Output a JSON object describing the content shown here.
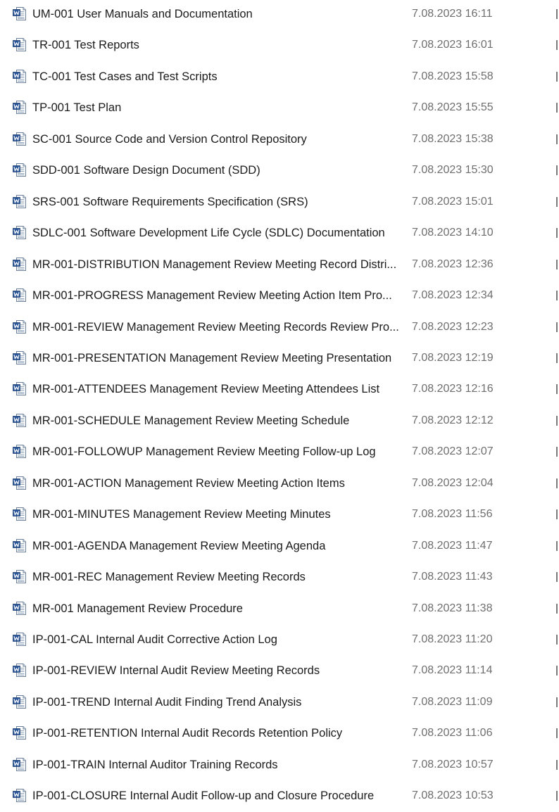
{
  "files": [
    {
      "name": "UM-001 User Manuals and Documentation",
      "modified": "7.08.2023 16:11",
      "icon": "word-document-icon"
    },
    {
      "name": "TR-001 Test Reports",
      "modified": "7.08.2023 16:01",
      "icon": "word-document-icon"
    },
    {
      "name": "TC-001 Test Cases and Test Scripts",
      "modified": "7.08.2023 15:58",
      "icon": "word-document-icon"
    },
    {
      "name": "TP-001 Test Plan",
      "modified": "7.08.2023 15:55",
      "icon": "word-document-icon"
    },
    {
      "name": "SC-001 Source Code and Version Control Repository",
      "modified": "7.08.2023 15:38",
      "icon": "word-document-icon"
    },
    {
      "name": "SDD-001 Software Design Document (SDD)",
      "modified": "7.08.2023 15:30",
      "icon": "word-document-icon"
    },
    {
      "name": "SRS-001 Software Requirements Specification (SRS)",
      "modified": "7.08.2023 15:01",
      "icon": "word-document-icon"
    },
    {
      "name": "SDLC-001 Software Development Life Cycle (SDLC) Documentation",
      "modified": "7.08.2023 14:10",
      "icon": "word-document-icon"
    },
    {
      "name": "MR-001-DISTRIBUTION Management Review Meeting Record Distri...",
      "modified": "7.08.2023 12:36",
      "icon": "word-document-icon"
    },
    {
      "name": "MR-001-PROGRESS Management Review Meeting Action Item Pro...",
      "modified": "7.08.2023 12:34",
      "icon": "word-document-icon"
    },
    {
      "name": "MR-001-REVIEW Management Review Meeting Records Review Pro...",
      "modified": "7.08.2023 12:23",
      "icon": "word-document-icon"
    },
    {
      "name": "MR-001-PRESENTATION Management Review Meeting Presentation",
      "modified": "7.08.2023 12:19",
      "icon": "word-document-icon"
    },
    {
      "name": "MR-001-ATTENDEES Management Review Meeting Attendees List",
      "modified": "7.08.2023 12:16",
      "icon": "word-document-icon"
    },
    {
      "name": "MR-001-SCHEDULE Management Review Meeting Schedule",
      "modified": "7.08.2023 12:12",
      "icon": "word-document-icon"
    },
    {
      "name": "MR-001-FOLLOWUP Management Review Meeting Follow-up Log",
      "modified": "7.08.2023 12:07",
      "icon": "word-document-icon"
    },
    {
      "name": "MR-001-ACTION Management Review Meeting Action Items",
      "modified": "7.08.2023 12:04",
      "icon": "word-document-icon"
    },
    {
      "name": "MR-001-MINUTES Management Review Meeting Minutes",
      "modified": "7.08.2023 11:56",
      "icon": "word-document-icon"
    },
    {
      "name": "MR-001-AGENDA Management Review Meeting Agenda",
      "modified": "7.08.2023 11:47",
      "icon": "word-document-icon"
    },
    {
      "name": "MR-001-REC Management Review Meeting Records",
      "modified": "7.08.2023 11:43",
      "icon": "word-document-icon"
    },
    {
      "name": "MR-001 Management Review Procedure",
      "modified": "7.08.2023 11:38",
      "icon": "word-document-icon"
    },
    {
      "name": "IP-001-CAL Internal Audit Corrective Action Log",
      "modified": "7.08.2023 11:20",
      "icon": "word-document-icon"
    },
    {
      "name": "IP-001-REVIEW Internal Audit Review Meeting Records",
      "modified": "7.08.2023 11:14",
      "icon": "word-document-icon"
    },
    {
      "name": "IP-001-TREND Internal Audit Finding Trend Analysis",
      "modified": "7.08.2023 11:09",
      "icon": "word-document-icon"
    },
    {
      "name": "IP-001-RETENTION Internal Audit Records Retention Policy",
      "modified": "7.08.2023 11:06",
      "icon": "word-document-icon"
    },
    {
      "name": "IP-001-TRAIN Internal Auditor Training Records",
      "modified": "7.08.2023 10:57",
      "icon": "word-document-icon"
    },
    {
      "name": "IP-001-CLOSURE Internal Audit Follow-up and Closure Procedure",
      "modified": "7.08.2023 10:53",
      "icon": "word-document-icon"
    }
  ],
  "colors": {
    "word_blue": "#2b579a",
    "text": "#1b1b1b",
    "date_text": "#6e6e6e",
    "background": "#ffffff"
  }
}
